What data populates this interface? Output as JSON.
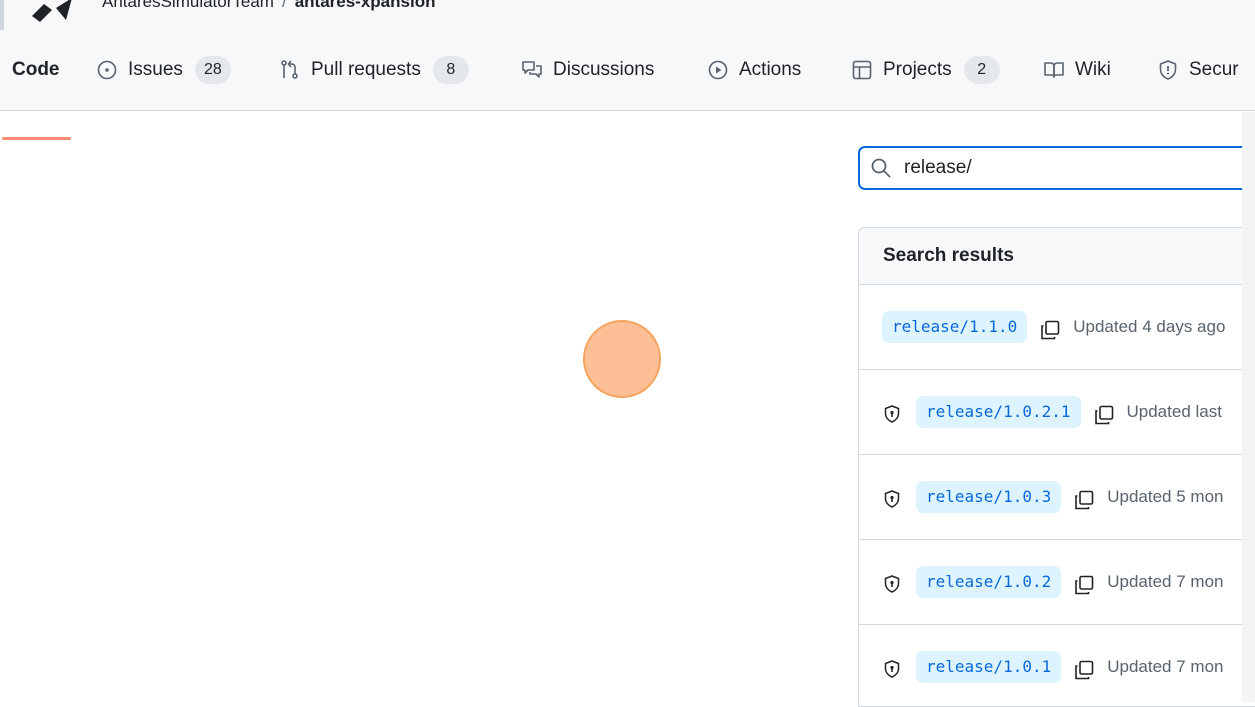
{
  "header": {
    "owner": "AntaresSimulatorTeam",
    "separator": "/",
    "repo": "antares-xpansion"
  },
  "tabs": [
    {
      "label": "Code",
      "icon": "code-icon",
      "counter": null,
      "active": true
    },
    {
      "label": "Issues",
      "icon": "issue-opened-icon",
      "counter": "28"
    },
    {
      "label": "Pull requests",
      "icon": "git-pull-request-icon",
      "counter": "8"
    },
    {
      "label": "Discussions",
      "icon": "comment-discussion-icon",
      "counter": null
    },
    {
      "label": "Actions",
      "icon": "play-icon",
      "counter": null
    },
    {
      "label": "Projects",
      "icon": "table-icon",
      "counter": "2"
    },
    {
      "label": "Wiki",
      "icon": "book-icon",
      "counter": null
    },
    {
      "label": "Secur",
      "icon": "shield-icon",
      "counter": null
    }
  ],
  "search": {
    "value": "release/",
    "icon": "search-icon"
  },
  "results": {
    "title": "Search results",
    "items": [
      {
        "branch": "release/1.1.0",
        "updated": "Updated 4 days ago",
        "protected": false
      },
      {
        "branch": "release/1.0.2.1",
        "updated": "Updated last",
        "protected": true
      },
      {
        "branch": "release/1.0.3",
        "updated": "Updated 5 mon",
        "protected": true
      },
      {
        "branch": "release/1.0.2",
        "updated": "Updated 7 mon",
        "protected": true
      },
      {
        "branch": "release/1.0.1",
        "updated": "Updated 7 mon",
        "protected": true
      }
    ]
  },
  "colors": {
    "accent": "#0969da",
    "active_tab_underline": "#fd8c73",
    "cursor_indicator": "#fdb482"
  }
}
